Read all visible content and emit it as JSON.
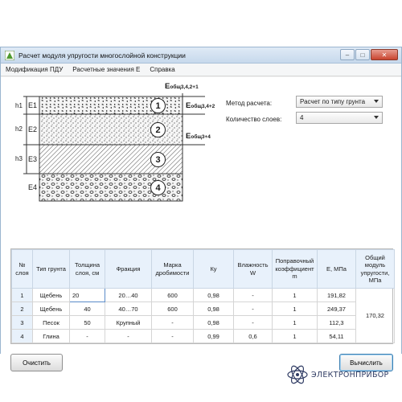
{
  "window": {
    "title": "Расчет модуля упругости многослойной конструкции",
    "minimize": "–",
    "maximize": "□",
    "close": "✕"
  },
  "menu": {
    "items": [
      "Модификация ПДУ",
      "Расчетные значения Е",
      "Справка"
    ]
  },
  "diagram": {
    "layers": [
      {
        "num": "1",
        "e": "E1",
        "h": "h1"
      },
      {
        "num": "2",
        "e": "E2",
        "h": "h2"
      },
      {
        "num": "3",
        "e": "E3",
        "h": "h3"
      },
      {
        "num": "4",
        "e": "E4",
        "h": ""
      }
    ],
    "eg_labels": [
      {
        "main": "E",
        "sub": "общ3,4,2+1"
      },
      {
        "main": "E",
        "sub": "общ3,4+2"
      },
      {
        "main": "E",
        "sub": "общ3+4"
      }
    ]
  },
  "form": {
    "method_label": "Метод расчета:",
    "method_value": "Расчет по типу грунта",
    "layers_label": "Количество слоев:",
    "layers_value": "4"
  },
  "table": {
    "headers": [
      "№ слоя",
      "Тип грунта",
      "Толщина слоя, см",
      "Фракция",
      "Марка дробимости",
      "Ку",
      "Влажность W",
      "Поправочный коэффициент m",
      "Е, МПа",
      "Общий модуль упругости, МПа"
    ],
    "rows": [
      {
        "num": "1",
        "type": "Щебень",
        "thickness": "20",
        "fraction": "20…40",
        "grade": "600",
        "ku": "0,98",
        "w": "-",
        "m": "1",
        "e": "191,82"
      },
      {
        "num": "2",
        "type": "Щебень",
        "thickness": "40",
        "fraction": "40…70",
        "grade": "600",
        "ku": "0,98",
        "w": "-",
        "m": "1",
        "e": "249,37"
      },
      {
        "num": "3",
        "type": "Песок",
        "thickness": "50",
        "fraction": "Крупный",
        "grade": "-",
        "ku": "0,98",
        "w": "-",
        "m": "1",
        "e": "112,3"
      },
      {
        "num": "4",
        "type": "Глина",
        "thickness": "-",
        "fraction": "-",
        "grade": "-",
        "ku": "0,99",
        "w": "0,6",
        "m": "1",
        "e": "54,11"
      }
    ],
    "total_modulus": "170,32"
  },
  "buttons": {
    "clear": "Очистить",
    "calculate": "Вычислить"
  },
  "brand": {
    "name": "ЭЛЕКТРОНПРИБОР"
  }
}
